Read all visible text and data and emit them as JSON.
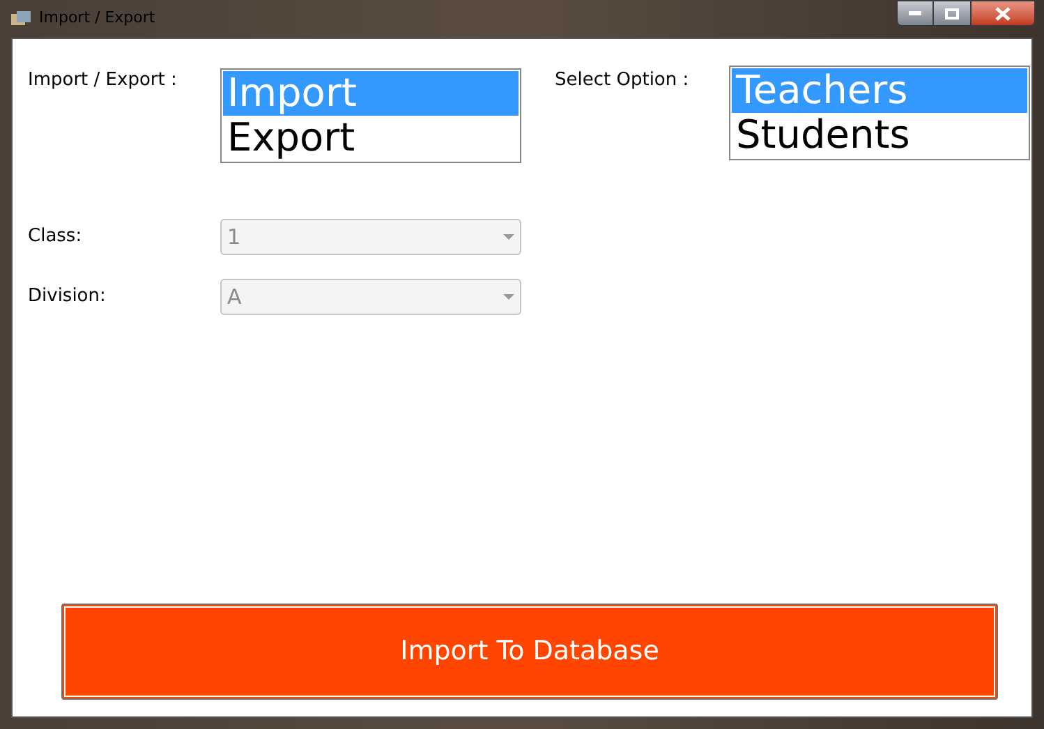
{
  "window": {
    "title": "Import / Export"
  },
  "import_export": {
    "label": "Import / Export :",
    "options": [
      {
        "label": "Import",
        "selected": true
      },
      {
        "label": "Export",
        "selected": false
      }
    ]
  },
  "select_option": {
    "label": "Select Option :",
    "options": [
      {
        "label": "Teachers",
        "selected": true
      },
      {
        "label": "Students",
        "selected": false
      }
    ]
  },
  "class": {
    "label": "Class:",
    "value": "1",
    "disabled": true
  },
  "division": {
    "label": "Division:",
    "value": "A",
    "disabled": true
  },
  "action_button": {
    "label": "Import To Database"
  }
}
